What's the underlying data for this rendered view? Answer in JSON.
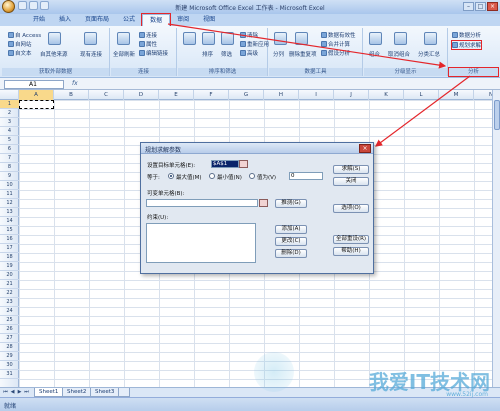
{
  "window": {
    "title": "新建 Microsoft Office Excel 工作表 - Microsoft Excel",
    "controls": [
      "–",
      "□",
      "×"
    ]
  },
  "ribbon_tabs": [
    "开始",
    "插入",
    "页面布局",
    "公式",
    "数据",
    "审阅",
    "视图"
  ],
  "active_tab": "数据",
  "ribbon": {
    "get_external": {
      "label": "获取外部数据",
      "items": [
        "自 Access",
        "自网站",
        "自文本",
        "自其他来源",
        "现有连接"
      ]
    },
    "connections": {
      "label": "连接",
      "items": [
        "全部刷新",
        "连接",
        "属性",
        "编辑链接"
      ]
    },
    "sort_filter": {
      "label": "排序和筛选",
      "items": [
        "排序",
        "筛选",
        "清除",
        "重新应用",
        "高级"
      ]
    },
    "data_tools": {
      "label": "数据工具",
      "items": [
        "分列",
        "删除重复项",
        "数据有效性",
        "合并计算",
        "假设分析"
      ]
    },
    "outline": {
      "label": "分级显示",
      "items": [
        "组合",
        "取消组合",
        "分类汇总"
      ]
    },
    "analysis": {
      "label": "分析",
      "items": [
        "数据分析",
        "规划求解"
      ]
    }
  },
  "formula_bar": {
    "name_box": "A1",
    "fx": "fx"
  },
  "columns": [
    "A",
    "B",
    "C",
    "D",
    "E",
    "F",
    "G",
    "H",
    "I",
    "J",
    "K",
    "L",
    "M",
    "N"
  ],
  "rows": [
    "1",
    "2",
    "3",
    "4",
    "5",
    "6",
    "7",
    "8",
    "9",
    "10",
    "11",
    "12",
    "13",
    "14",
    "15",
    "16",
    "17",
    "18",
    "19",
    "20",
    "21",
    "22",
    "23",
    "24",
    "25",
    "26",
    "27",
    "28",
    "29",
    "30",
    "31"
  ],
  "sheets": [
    "Sheet1",
    "Sheet2",
    "Sheet3"
  ],
  "sheet_nav": [
    "⏮",
    "◀",
    "▶",
    "⏭"
  ],
  "status": "就绪",
  "dialog": {
    "title": "规划求解参数",
    "close": "×",
    "target_label": "设置目标单元格(E):",
    "target_value": "$A$1",
    "equal_label": "等于:",
    "opt_max": "最大值(M)",
    "opt_min": "最小值(N)",
    "opt_value": "值为(V)",
    "value_input": "0",
    "changing_label": "可变单元格(B):",
    "guess_button": "推测(G)",
    "constraints_label": "约束(U):",
    "add_button": "添加(A)",
    "change_button": "更改(C)",
    "delete_button": "删除(D)",
    "solve_button": "求解(S)",
    "close_button": "关闭",
    "options_button": "选项(O)",
    "reset_button": "全部重设(R)",
    "help_button": "帮助(H)"
  },
  "watermark": {
    "text": "我爱IT技术网",
    "sub": "www.52ij.com"
  },
  "colors": {
    "highlight": "#e4262b",
    "ribbon": "#d7e6f7",
    "title": "#a9c6ec"
  }
}
